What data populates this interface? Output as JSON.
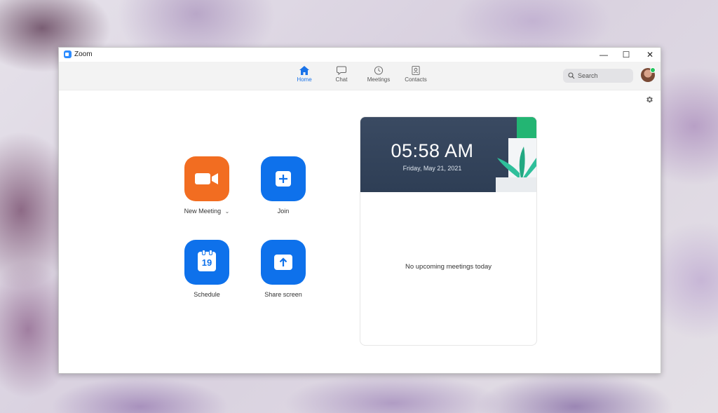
{
  "window": {
    "title": "Zoom",
    "controls": {
      "minimize": "—",
      "maximize": "☐",
      "close": "✕"
    }
  },
  "nav": {
    "tabs": [
      {
        "label": "Home",
        "icon": "home-icon",
        "active": true
      },
      {
        "label": "Chat",
        "icon": "chat-icon",
        "active": false
      },
      {
        "label": "Meetings",
        "icon": "clock-icon",
        "active": false
      },
      {
        "label": "Contacts",
        "icon": "contacts-icon",
        "active": false
      }
    ],
    "search_placeholder": "Search",
    "presence_color": "#22c55e"
  },
  "actions": [
    {
      "label": "New Meeting",
      "icon": "video-camera-icon",
      "color": "#f26d21",
      "has_dropdown": true
    },
    {
      "label": "Join",
      "icon": "plus-icon",
      "color": "#0e71eb"
    },
    {
      "label": "Schedule",
      "icon": "calendar-icon",
      "color": "#0e71eb",
      "calendar_day": "19"
    },
    {
      "label": "Share screen",
      "icon": "upload-arrow-icon",
      "color": "#0e71eb"
    }
  ],
  "clock": {
    "time": "05:58 AM",
    "date": "Friday, May 21, 2021"
  },
  "meetings": {
    "empty_message": "No upcoming meetings today"
  },
  "colors": {
    "accent": "#1a73e8",
    "card_header": "#33435a"
  }
}
